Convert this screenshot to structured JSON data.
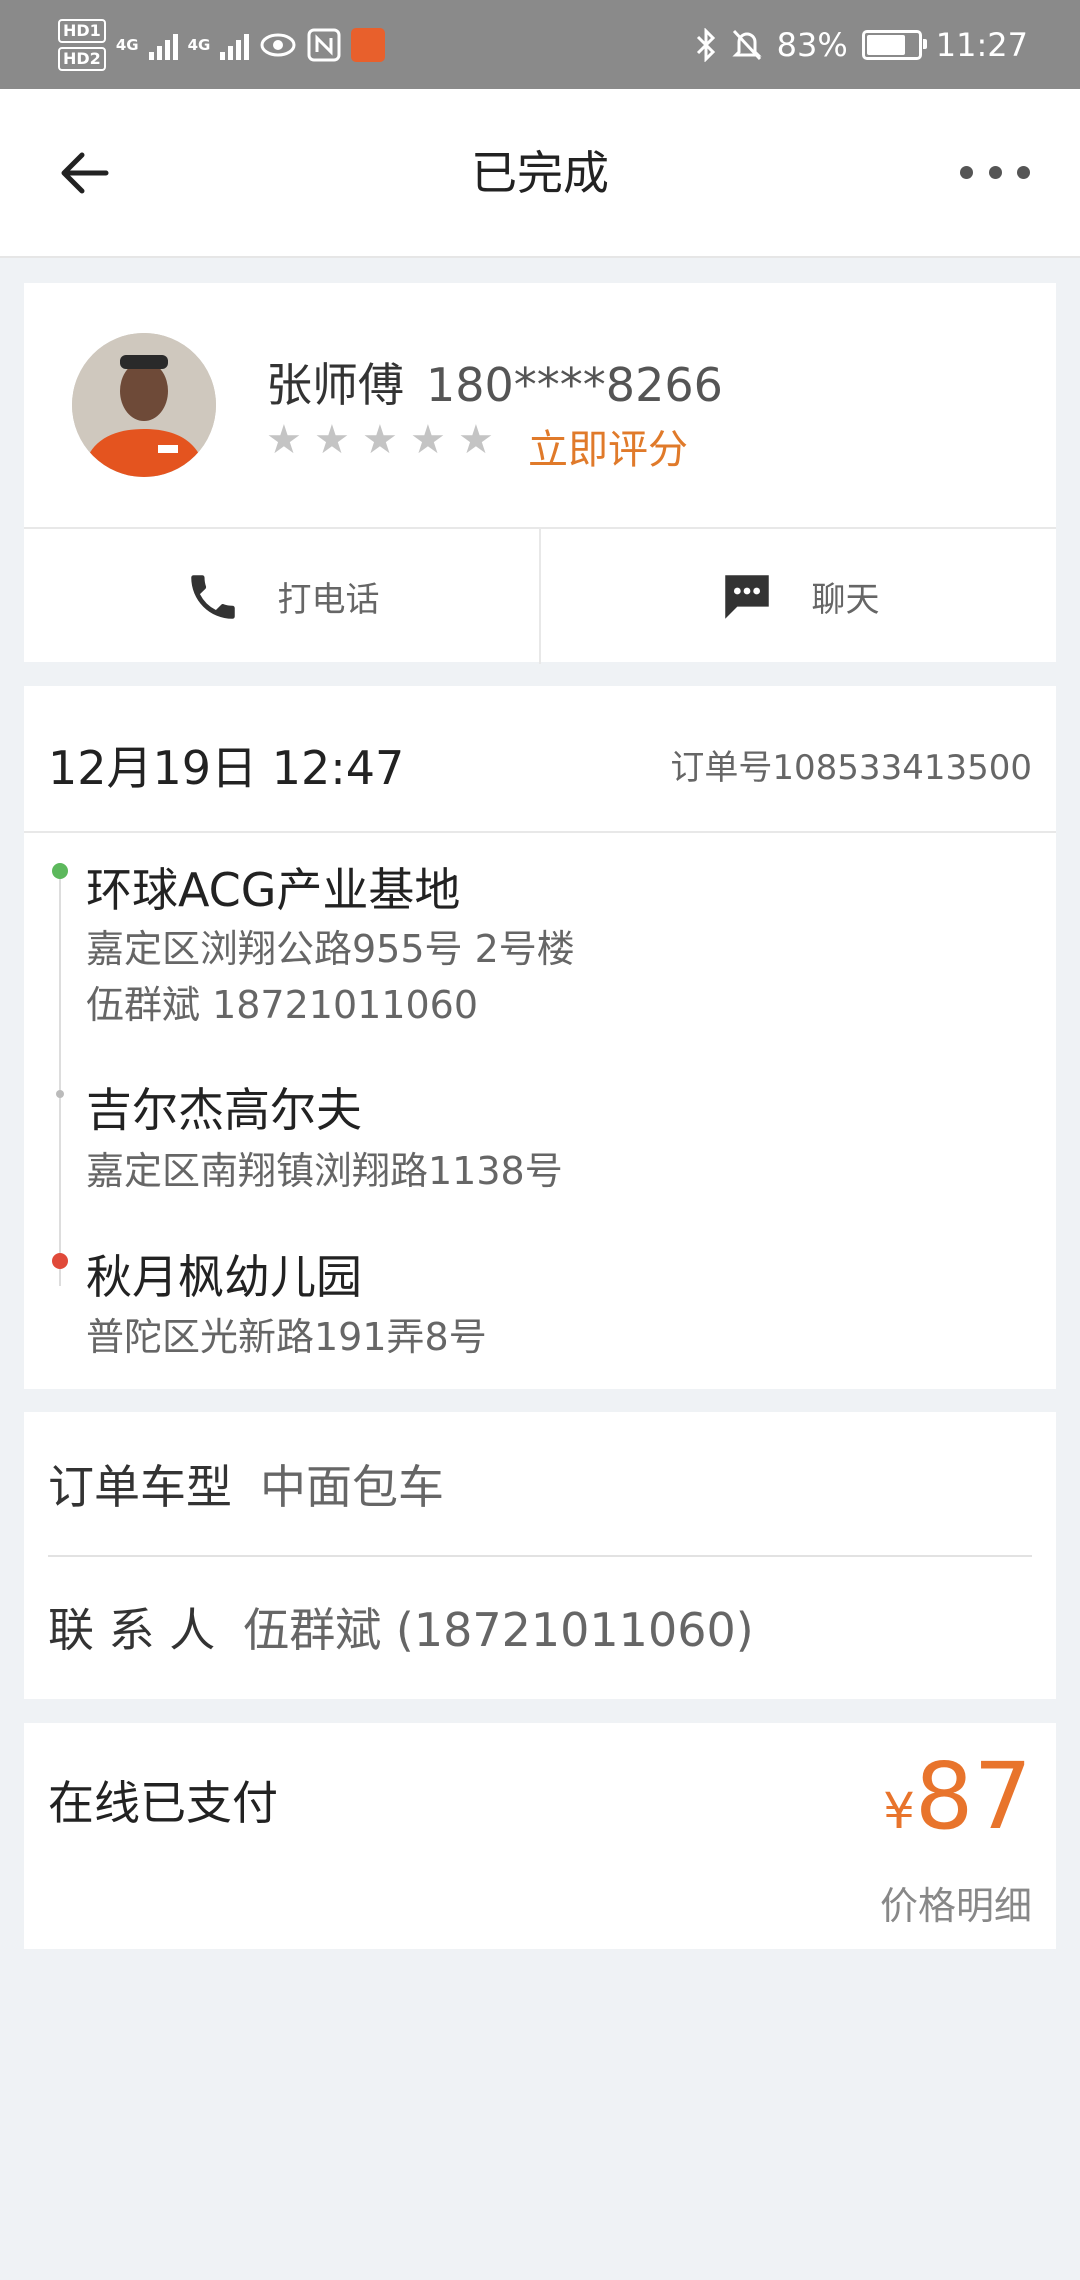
{
  "status_bar": {
    "hd1": "HD1",
    "hd2": "HD2",
    "net1": "4G",
    "net2": "4G",
    "battery_percent": "83%",
    "battery_level": 0.83,
    "time": "11:27",
    "icons": [
      "eye-icon",
      "nfc-icon",
      "app-icon",
      "bluetooth-icon",
      "bell-off-icon"
    ]
  },
  "nav": {
    "title": "已完成",
    "back_icon": "arrow-left-icon",
    "more_icon": "more-dots-icon"
  },
  "driver": {
    "name": "张师傅",
    "phone": "180****8266",
    "rating_stars": 5,
    "rate_label": "立即评分",
    "call_label": "打电话",
    "chat_label": "聊天"
  },
  "order": {
    "time": "12月19日 12:47",
    "number": "订单号108533413500",
    "stops": [
      {
        "title": "环球ACG产业基地",
        "address": "嘉定区浏翔公路955号  2号楼",
        "contact": "伍群斌  18721011060",
        "color": "#5cb85c"
      },
      {
        "title": "吉尔杰高尔夫",
        "address": "嘉定区南翔镇浏翔路1138号",
        "color": "#bbbbbb"
      },
      {
        "title": "秋月枫幼儿园",
        "address": "普陀区光新路191弄8号",
        "color": "#e04a3a"
      }
    ]
  },
  "info": {
    "vehicle_label": "订单车型",
    "vehicle_value": "中面包车",
    "contact_label": "联 系 人",
    "contact_value": "伍群斌 (18721011060)"
  },
  "payment": {
    "label": "在线已支付",
    "currency": "¥",
    "amount": "87",
    "detail_link": "价格明细",
    "accent_color": "#e8742c"
  }
}
